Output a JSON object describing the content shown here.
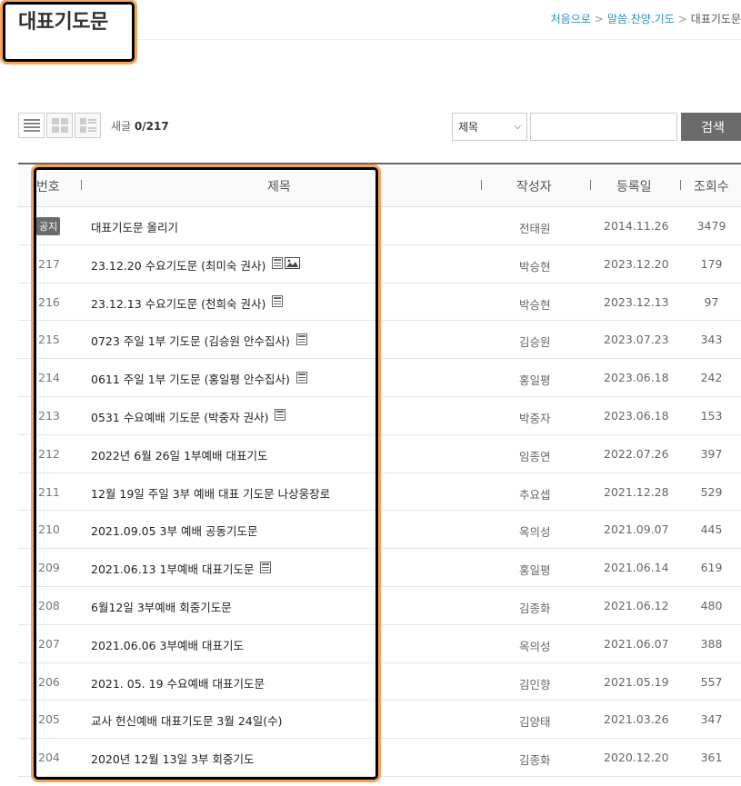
{
  "page": {
    "title": "대표기도문",
    "breadcrumb": [
      "처음으로",
      "말씀.찬양.기도",
      "대표기도문"
    ]
  },
  "toolbar": {
    "post_count_label": "새글",
    "post_count_value": "0/217",
    "search_select_value": "제목",
    "search_input_value": "",
    "search_button_label": "검색",
    "view_modes": [
      "list-view-icon",
      "gallery-view-icon",
      "webzine-view-icon"
    ]
  },
  "table": {
    "columns": [
      "번호",
      "제목",
      "작성자",
      "등록일",
      "조회수"
    ],
    "notice_label": "공지",
    "rows": [
      {
        "num": "공지",
        "title": "대표기도문 올리기",
        "author": "전태원",
        "date": "2014.11.26",
        "views": "3479",
        "file": false,
        "image": false
      },
      {
        "num": "217",
        "title": "23.12.20 수요기도문 (최미숙 권사)",
        "author": "박승현",
        "date": "2023.12.20",
        "views": "179",
        "file": true,
        "image": true
      },
      {
        "num": "216",
        "title": "23.12.13 수요기도문 (천희숙 권사)",
        "author": "박승현",
        "date": "2023.12.13",
        "views": "97",
        "file": true,
        "image": false
      },
      {
        "num": "215",
        "title": "0723 주일 1부 기도문 (김승원 안수집사)",
        "author": "김승원",
        "date": "2023.07.23",
        "views": "343",
        "file": true,
        "image": false
      },
      {
        "num": "214",
        "title": "0611 주일 1부 기도문 (홍일평 안수집사)",
        "author": "홍일평",
        "date": "2023.06.18",
        "views": "242",
        "file": true,
        "image": false
      },
      {
        "num": "213",
        "title": "0531 수요예배 기도문 (박중자 권사)",
        "author": "박중자",
        "date": "2023.06.18",
        "views": "153",
        "file": true,
        "image": false
      },
      {
        "num": "212",
        "title": "2022년 6월 26일 1부예배 대표기도",
        "author": "임종연",
        "date": "2022.07.26",
        "views": "397",
        "file": false,
        "image": false
      },
      {
        "num": "211",
        "title": "12월 19일 주일 3부 예배 대표 기도문 나상웅장로",
        "author": "추요셉",
        "date": "2021.12.28",
        "views": "529",
        "file": false,
        "image": false
      },
      {
        "num": "210",
        "title": "2021.09.05 3부 예배 공동기도문",
        "author": "옥의성",
        "date": "2021.09.07",
        "views": "445",
        "file": false,
        "image": false
      },
      {
        "num": "209",
        "title": "2021.06.13 1부예배 대표기도문",
        "author": "홍일평",
        "date": "2021.06.14",
        "views": "619",
        "file": true,
        "image": false
      },
      {
        "num": "208",
        "title": "6월12일 3부예배 회중기도문",
        "author": "김종화",
        "date": "2021.06.12",
        "views": "480",
        "file": false,
        "image": false
      },
      {
        "num": "207",
        "title": "2021.06.06 3부예배 대표기도",
        "author": "옥의성",
        "date": "2021.06.07",
        "views": "388",
        "file": false,
        "image": false
      },
      {
        "num": "206",
        "title": "2021. 05. 19 수요예배 대표기도문",
        "author": "김인향",
        "date": "2021.05.19",
        "views": "557",
        "file": false,
        "image": false
      },
      {
        "num": "205",
        "title": "교사 헌신예배 대표기도문 3월 24일(수)",
        "author": "김양태",
        "date": "2021.03.26",
        "views": "347",
        "file": false,
        "image": false
      },
      {
        "num": "204",
        "title": "2020년 12월 13일 3부 회중기도",
        "author": "김종화",
        "date": "2020.12.20",
        "views": "361",
        "file": false,
        "image": false
      }
    ]
  },
  "colors": {
    "highlight_border": "#000000",
    "highlight_glow": "#f5a65b",
    "breadcrumb_link": "#2a8fbd",
    "button_bg": "#6b6b6b"
  }
}
